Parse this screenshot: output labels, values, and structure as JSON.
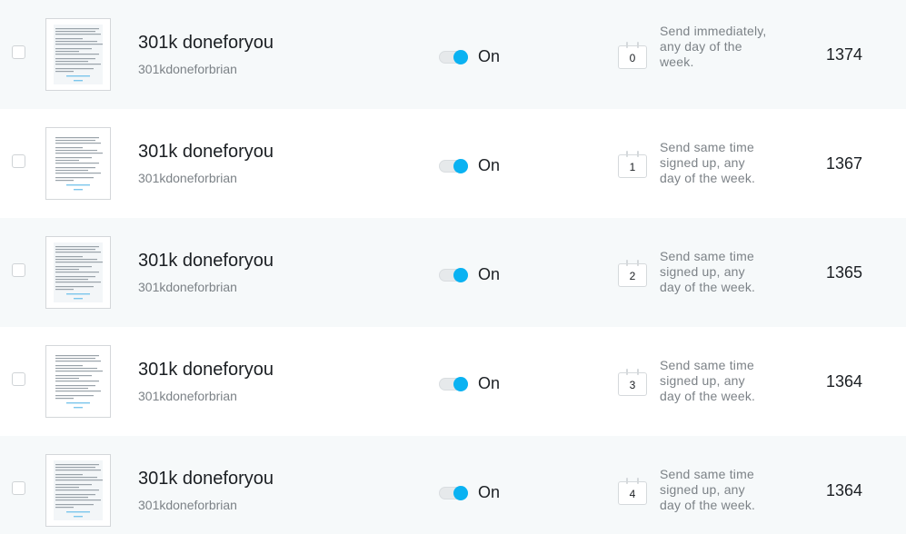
{
  "rows": [
    {
      "title": "301k doneforyou",
      "subtitle": "301kdoneforbrian",
      "toggle_label": "On",
      "day": "0",
      "schedule": "Send immediately, any day of the week.",
      "count": "1374"
    },
    {
      "title": "301k doneforyou",
      "subtitle": "301kdoneforbrian",
      "toggle_label": "On",
      "day": "1",
      "schedule": "Send same time signed up, any day of the week.",
      "count": "1367"
    },
    {
      "title": "301k doneforyou",
      "subtitle": "301kdoneforbrian",
      "toggle_label": "On",
      "day": "2",
      "schedule": "Send same time signed up, any day of the week.",
      "count": "1365"
    },
    {
      "title": "301k doneforyou",
      "subtitle": "301kdoneforbrian",
      "toggle_label": "On",
      "day": "3",
      "schedule": "Send same time signed up, any day of the week.",
      "count": "1364"
    },
    {
      "title": "301k doneforyou",
      "subtitle": "301kdoneforbrian",
      "toggle_label": "On",
      "day": "4",
      "schedule": "Send same time signed up, any day of the week.",
      "count": "1364"
    }
  ],
  "colors": {
    "accent": "#0ab2f2",
    "row_alt": "#f6f9fa",
    "text": "#1b1f23",
    "muted": "#7c8287"
  },
  "icons": {
    "calendar": "calendar-icon",
    "thumbnail": "email-preview-thumbnail"
  }
}
